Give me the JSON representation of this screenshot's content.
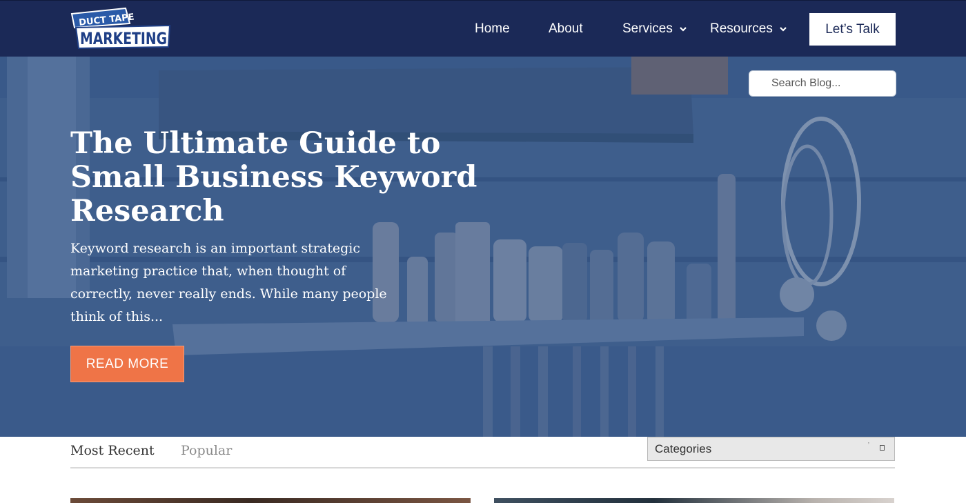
{
  "header": {
    "logo": {
      "line1": "DUCT TAPE",
      "line2": "MARKETING"
    },
    "nav": [
      {
        "label": "Home"
      },
      {
        "label": "About"
      },
      {
        "label": "Services",
        "icon": "chevron-down-icon"
      },
      {
        "label": "Resources",
        "icon": "chevron-down-icon"
      }
    ],
    "cta_label": "Let’s Talk"
  },
  "hero": {
    "search_placeholder": "Search Blog...",
    "title": "The Ultimate Guide to Small Business Keyword Research",
    "excerpt": "Keyword research is an important strategic marketing practice that, when thought of correctly, never really ends. While many people think of this...",
    "read_more_label": "READ MORE"
  },
  "tabs": [
    {
      "label": "Most Recent",
      "active": true
    },
    {
      "label": "Popular",
      "active": false
    }
  ],
  "categories": {
    "selected": "Categories"
  },
  "colors": {
    "header_bg": "#1b2957",
    "accent_orange": "#ef7447",
    "hero_tint": "#4a6a94"
  }
}
